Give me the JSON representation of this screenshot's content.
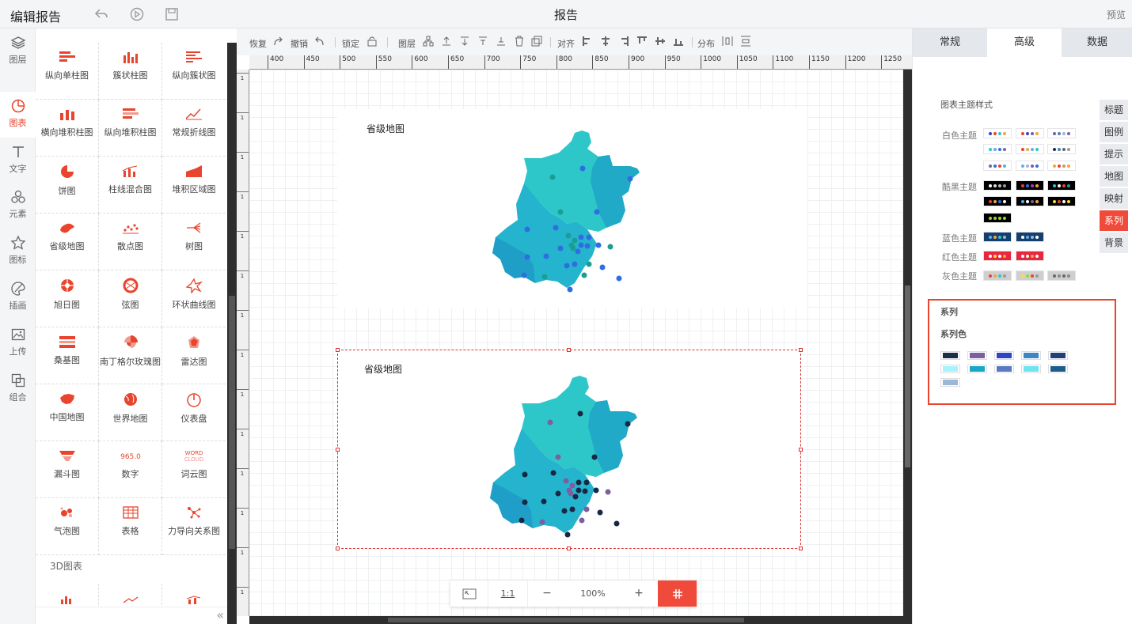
{
  "app": {
    "title": "编辑报告",
    "page_title": "报告",
    "preview": "预览"
  },
  "left_icons": [
    {
      "label": "图层",
      "icon": "layers-icon"
    },
    {
      "label": "图表",
      "icon": "chart-pie-icon",
      "active": true
    },
    {
      "label": "文字",
      "icon": "text-icon"
    },
    {
      "label": "元素",
      "icon": "elements-icon"
    },
    {
      "label": "图标",
      "icon": "star-icon"
    },
    {
      "label": "插画",
      "icon": "palette-icon"
    },
    {
      "label": "上传",
      "icon": "upload-image-icon"
    },
    {
      "label": "组合",
      "icon": "group-icon"
    }
  ],
  "charts": [
    "纵向单柱图",
    "簇状柱图",
    "纵向簇状图",
    "横向堆积柱图",
    "纵向堆积柱图",
    "常规折线图",
    "饼图",
    "柱线混合图",
    "堆积区域图",
    "省级地图",
    "散点图",
    "树图",
    "旭日图",
    "弦图",
    "环状曲线图",
    "桑基图",
    "南丁格尔玫瑰图",
    "雷达图",
    "中国地图",
    "世界地图",
    "仪表盘",
    "漏斗图",
    "数字",
    "词云图",
    "气泡图",
    "表格",
    "力导向关系图"
  ],
  "palette_section": "3D图表",
  "number_icon_text": "965.0",
  "wordcloud_icon_text": [
    "WORD",
    "CLOUD"
  ],
  "toolbar": {
    "redo": "恢复",
    "undo": "撤销",
    "lock": "锁定",
    "layer": "图层",
    "align": "对齐",
    "distribute": "分布"
  },
  "ruler": {
    "top": [
      "400",
      "450",
      "500",
      "550",
      "600",
      "650",
      "700",
      "750",
      "800",
      "850",
      "900",
      "950",
      "1000",
      "1050",
      "1100",
      "1150",
      "1200",
      "1250"
    ],
    "left": [
      "1",
      "1",
      "1",
      "1",
      "1",
      "1",
      "1",
      "1",
      "1",
      "1",
      "1",
      "1",
      "1",
      "1"
    ]
  },
  "canvas": {
    "chart1_title": "省级地图",
    "chart2_title": "省级地图"
  },
  "zoom": {
    "fit": "⤢",
    "one_to_one": "1:1",
    "minus": "−",
    "level": "100%",
    "plus": "+"
  },
  "right_panel": {
    "tabs": [
      "常规",
      "高级",
      "数据"
    ],
    "active_tab": "高级",
    "section_title": "图表主题样式",
    "side_tabs": [
      "标题",
      "图例",
      "提示",
      "地图",
      "映射",
      "系列",
      "背景"
    ],
    "active_side_tab": "系列",
    "themes": [
      {
        "label": "白色主题"
      },
      {
        "label": "酷黑主题"
      },
      {
        "label": "蓝色主题"
      },
      {
        "label": "红色主题"
      },
      {
        "label": "灰色主题"
      }
    ],
    "series": {
      "title": "系列",
      "color_title": "系列色"
    },
    "series_colors": [
      "#1c2d4a",
      "#7b5fa0",
      "#2f45c8",
      "#3b86c5",
      "#1e3f7a",
      "#a6f3fb",
      "#1ba6c5",
      "#5b79c2",
      "#6ee4ee",
      "#1c5e8a",
      "#9ab8d8"
    ]
  },
  "map_colors": {
    "light": "#2ec7c9",
    "mid": "#25b4ce",
    "dark": "#1f9fc7"
  }
}
